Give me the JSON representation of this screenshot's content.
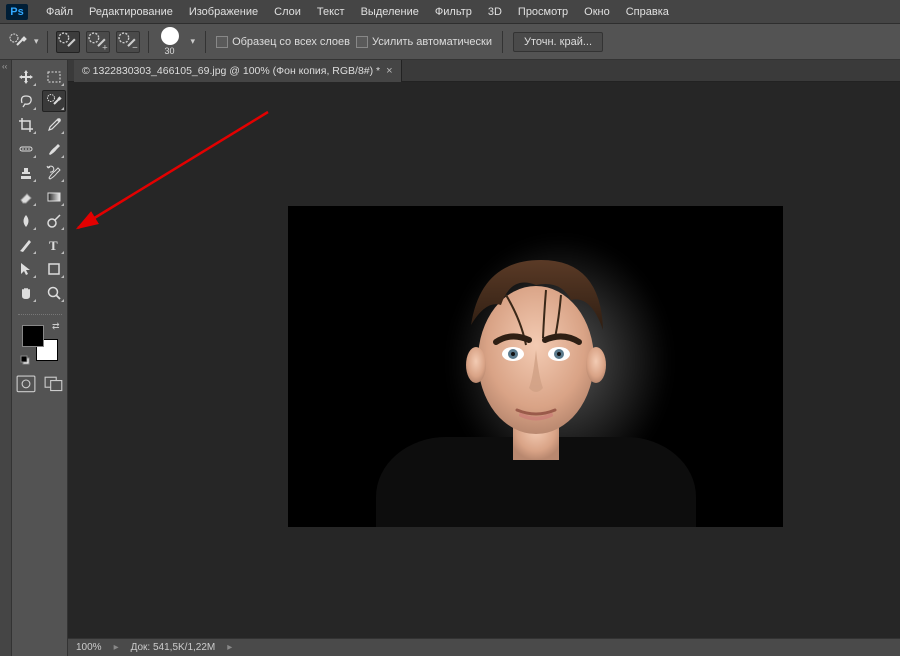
{
  "app_badge": "Ps",
  "menu": {
    "items": [
      "Файл",
      "Редактирование",
      "Изображение",
      "Слои",
      "Текст",
      "Выделение",
      "Фильтр",
      "3D",
      "Просмотр",
      "Окно",
      "Справка"
    ]
  },
  "options": {
    "brush_size": "30",
    "checkbox1": "Образец со всех слоев",
    "checkbox2": "Усилить автоматически",
    "refine_button": "Уточн. край..."
  },
  "document": {
    "tab_title": "© 1322830303_466105_69.jpg @ 100% (Фон копия, RGB/8#) *"
  },
  "status": {
    "zoom": "100%",
    "info": "Док: 541,5K/1,22M"
  },
  "toolbox": {
    "tools": [
      {
        "name": "move-tool",
        "icon": "move"
      },
      {
        "name": "marquee-tool",
        "icon": "marquee"
      },
      {
        "name": "lasso-tool",
        "icon": "lasso"
      },
      {
        "name": "quick-select-tool",
        "icon": "qsel",
        "selected": true
      },
      {
        "name": "crop-tool",
        "icon": "crop"
      },
      {
        "name": "eyedropper-tool",
        "icon": "eyedrop"
      },
      {
        "name": "healing-brush-tool",
        "icon": "heal"
      },
      {
        "name": "brush-tool",
        "icon": "brush"
      },
      {
        "name": "clone-stamp-tool",
        "icon": "stamp"
      },
      {
        "name": "history-brush-tool",
        "icon": "hist"
      },
      {
        "name": "eraser-tool",
        "icon": "eraser"
      },
      {
        "name": "gradient-tool",
        "icon": "grad"
      },
      {
        "name": "blur-tool",
        "icon": "blur"
      },
      {
        "name": "dodge-tool",
        "icon": "dodge"
      },
      {
        "name": "pen-tool",
        "icon": "pen"
      },
      {
        "name": "type-tool",
        "icon": "type"
      },
      {
        "name": "path-select-tool",
        "icon": "pathsel"
      },
      {
        "name": "shape-tool",
        "icon": "shape"
      },
      {
        "name": "hand-tool",
        "icon": "hand"
      },
      {
        "name": "zoom-tool",
        "icon": "zoom"
      }
    ]
  },
  "colors": {
    "canvas_bg": "#262626",
    "ui_bg": "#535353",
    "panel_bg": "#454545"
  }
}
